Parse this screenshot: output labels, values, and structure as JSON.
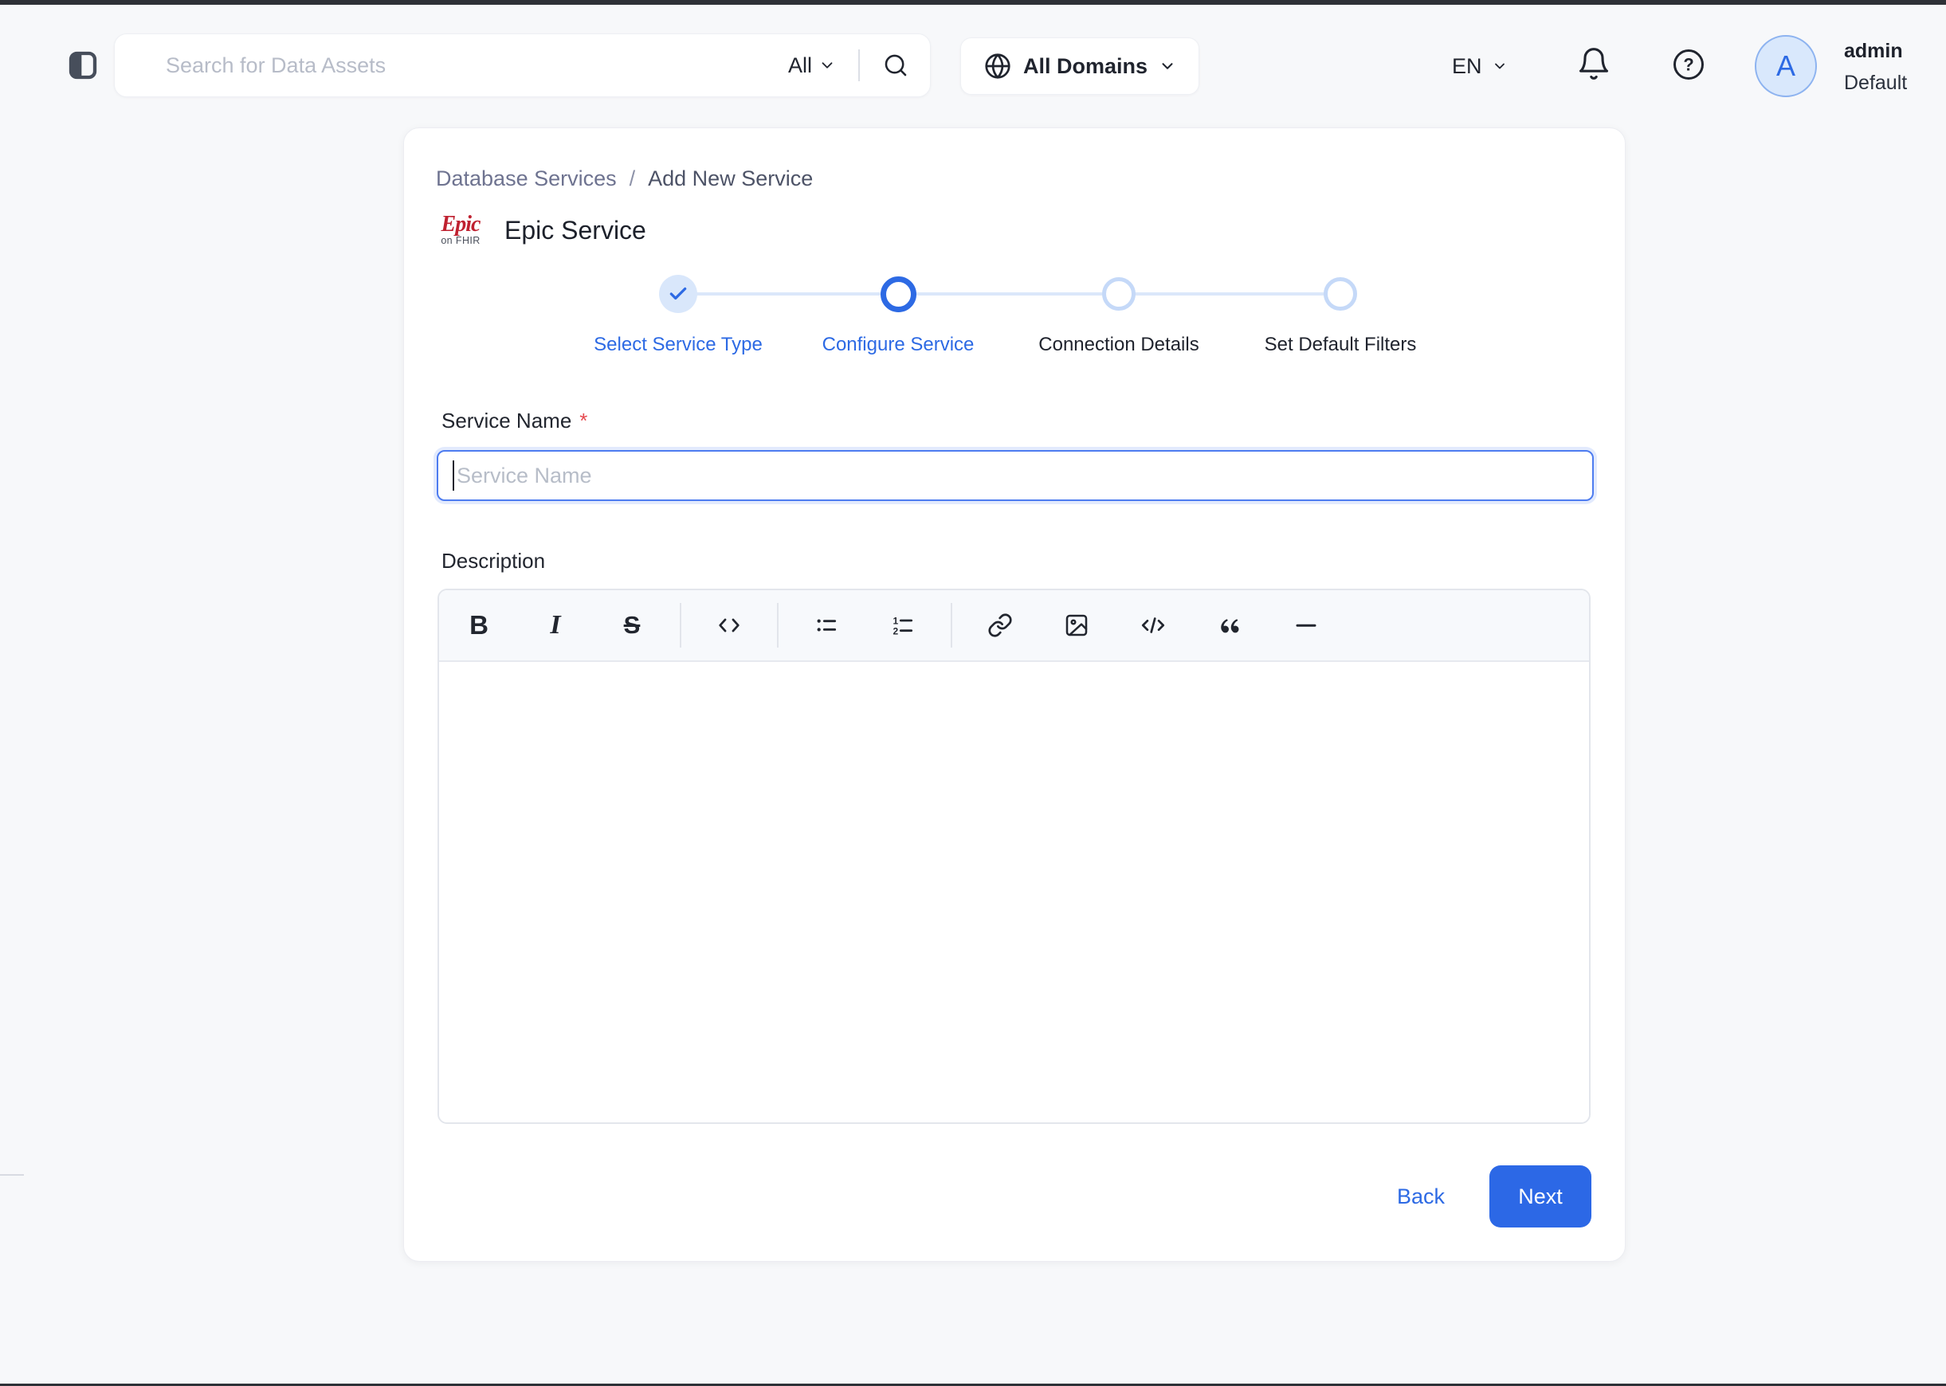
{
  "header": {
    "search": {
      "placeholder": "Search for Data Assets",
      "scope_label": "All"
    },
    "domains_button": {
      "label": "All Domains"
    },
    "language": {
      "label": "EN"
    },
    "user": {
      "initial": "A",
      "name": "admin",
      "team": "Default"
    }
  },
  "breadcrumb": {
    "separator": "/",
    "items": [
      {
        "label": "Database Services"
      },
      {
        "label": "Add New Service"
      }
    ]
  },
  "service": {
    "logo_word": "Epic",
    "logo_subtitle": "on FHIR",
    "title": "Epic Service"
  },
  "stepper": {
    "steps": [
      {
        "label": "Select Service Type",
        "state": "done"
      },
      {
        "label": "Configure Service",
        "state": "active"
      },
      {
        "label": "Connection Details",
        "state": "pending"
      },
      {
        "label": "Set Default Filters",
        "state": "pending"
      }
    ]
  },
  "form": {
    "service_name": {
      "label": "Service Name",
      "required_marker": "*",
      "placeholder": "Service Name",
      "value": ""
    },
    "description": {
      "label": "Description",
      "value": "",
      "toolbar_icons": [
        "bold",
        "italic",
        "strikethrough",
        "inline-code",
        "bulleted-list",
        "numbered-list",
        "link",
        "image",
        "code-block",
        "blockquote",
        "horizontal-rule"
      ]
    }
  },
  "footer": {
    "back_label": "Back",
    "next_label": "Next"
  },
  "colors": {
    "primary_blue": "#2c68e6",
    "stepper_blue": "#2d6ae4",
    "stepper_light_blue": "#d9e7fb",
    "page_background": "#f7f8fa",
    "epic_red": "#bf2130",
    "required_red": "#e5494f",
    "placeholder_gray": "#b7bdc8"
  }
}
